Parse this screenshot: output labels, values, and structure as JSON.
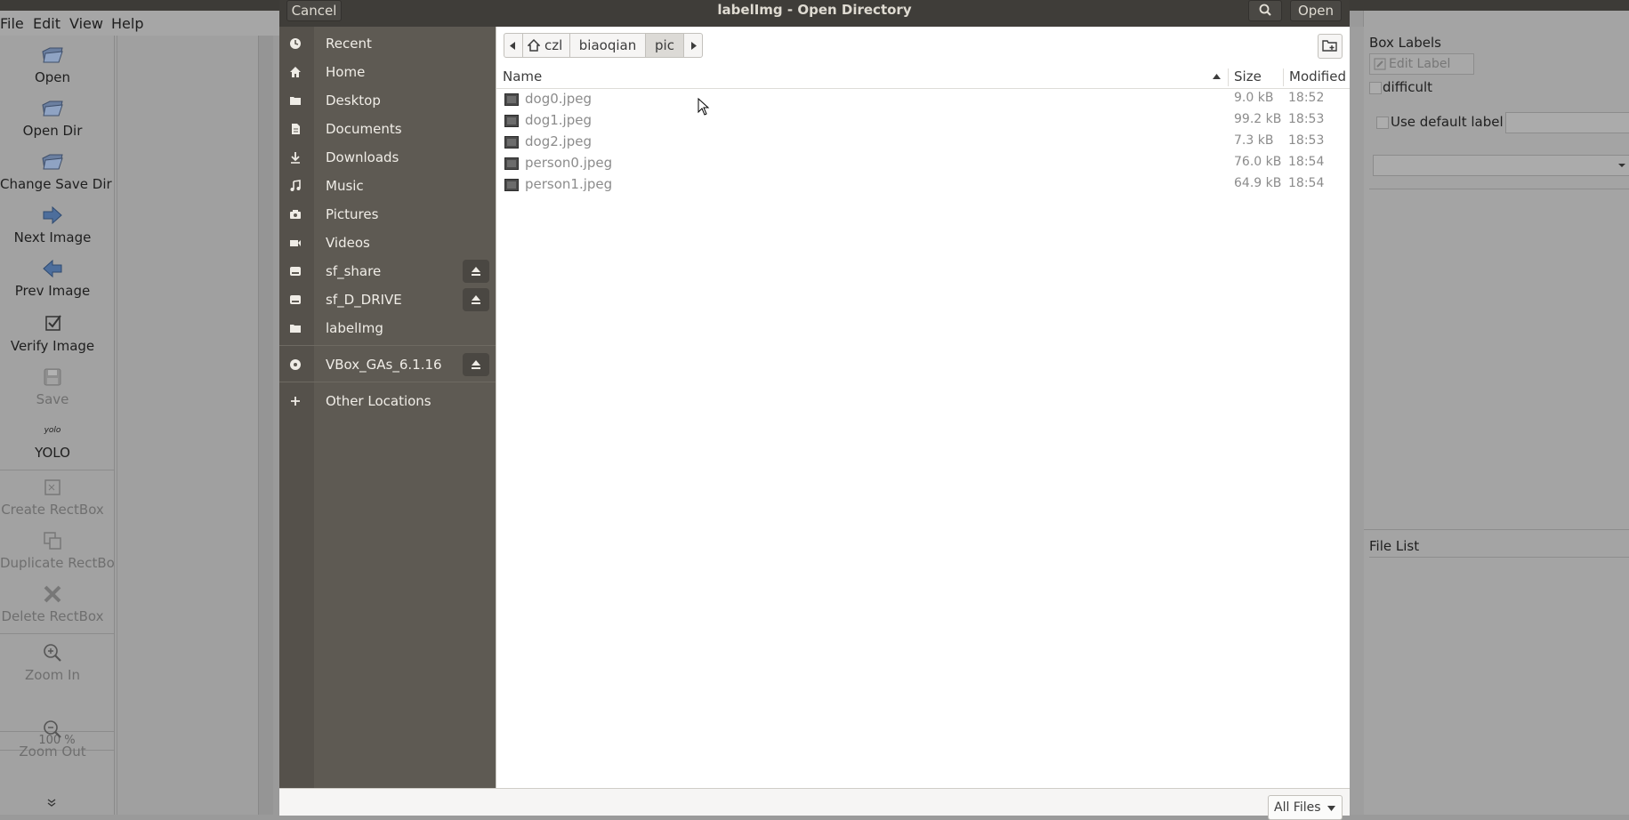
{
  "window": {
    "menu": [
      "File",
      "Edit",
      "View",
      "Help"
    ],
    "toolbar": [
      {
        "label": "Open",
        "icon": "open-folder-icon",
        "enabled": true
      },
      {
        "label": "Open Dir",
        "icon": "open-folder-icon",
        "enabled": true
      },
      {
        "label": "Change Save Dir",
        "icon": "open-folder-icon",
        "enabled": true
      },
      {
        "label": "Next Image",
        "icon": "arrow-right-icon",
        "enabled": true
      },
      {
        "label": "Prev Image",
        "icon": "arrow-left-icon",
        "enabled": true
      },
      {
        "label": "Verify Image",
        "icon": "checkbox-icon",
        "enabled": true
      },
      {
        "label": "Save",
        "icon": "save-icon",
        "enabled": false
      },
      {
        "label": "YOLO",
        "icon": "yolo-format-icon",
        "enabled": true
      },
      {
        "label": "Create RectBox",
        "icon": "create-rect-icon",
        "enabled": false
      },
      {
        "label": "Duplicate RectBox",
        "icon": "duplicate-rect-icon",
        "enabled": false
      },
      {
        "label": "Delete RectBox",
        "icon": "delete-rect-icon",
        "enabled": false
      },
      {
        "label": "Zoom In",
        "icon": "zoom-in-icon",
        "enabled": false
      },
      {
        "label": "Zoom Out",
        "icon": "zoom-out-icon",
        "enabled": false
      }
    ],
    "yolo_icon_text": "yolo",
    "zoom_value": "100 %",
    "right_panel": {
      "box_labels_title": "Box Labels",
      "edit_label": "Edit Label",
      "difficult": "difficult",
      "use_default_label": "Use default label",
      "file_list_title": "File List"
    }
  },
  "dialog": {
    "title": "labelImg - Open Directory",
    "cancel": "Cancel",
    "open": "Open",
    "sidebar": [
      {
        "label": "Recent",
        "icon": "recent-clock-icon",
        "eject": false
      },
      {
        "label": "Home",
        "icon": "home-icon",
        "eject": false
      },
      {
        "label": "Desktop",
        "icon": "folder-icon",
        "eject": false
      },
      {
        "label": "Documents",
        "icon": "document-icon",
        "eject": false
      },
      {
        "label": "Downloads",
        "icon": "download-icon",
        "eject": false
      },
      {
        "label": "Music",
        "icon": "music-icon",
        "eject": false
      },
      {
        "label": "Pictures",
        "icon": "camera-icon",
        "eject": false
      },
      {
        "label": "Videos",
        "icon": "video-icon",
        "eject": false
      },
      {
        "label": "sf_share",
        "icon": "drive-icon",
        "eject": true
      },
      {
        "label": "sf_D_DRIVE",
        "icon": "drive-icon",
        "eject": true
      },
      {
        "label": "labelImg",
        "icon": "folder-icon",
        "eject": false
      },
      {
        "label": "VBox_GAs_6.1.16",
        "icon": "disc-icon",
        "eject": true
      },
      {
        "label": "Other Locations",
        "icon": "plus-icon",
        "eject": false
      }
    ],
    "path": [
      "czl",
      "biaoqian",
      "pic"
    ],
    "columns": {
      "name": "Name",
      "size": "Size",
      "modified": "Modified"
    },
    "files": [
      {
        "name": "dog0.jpeg",
        "size": "9.0 kB",
        "modified": "18:52"
      },
      {
        "name": "dog1.jpeg",
        "size": "99.2 kB",
        "modified": "18:53"
      },
      {
        "name": "dog2.jpeg",
        "size": "7.3 kB",
        "modified": "18:53"
      },
      {
        "name": "person0.jpeg",
        "size": "76.0 kB",
        "modified": "18:54"
      },
      {
        "name": "person1.jpeg",
        "size": "64.9 kB",
        "modified": "18:54"
      }
    ],
    "filter": "All Files"
  }
}
